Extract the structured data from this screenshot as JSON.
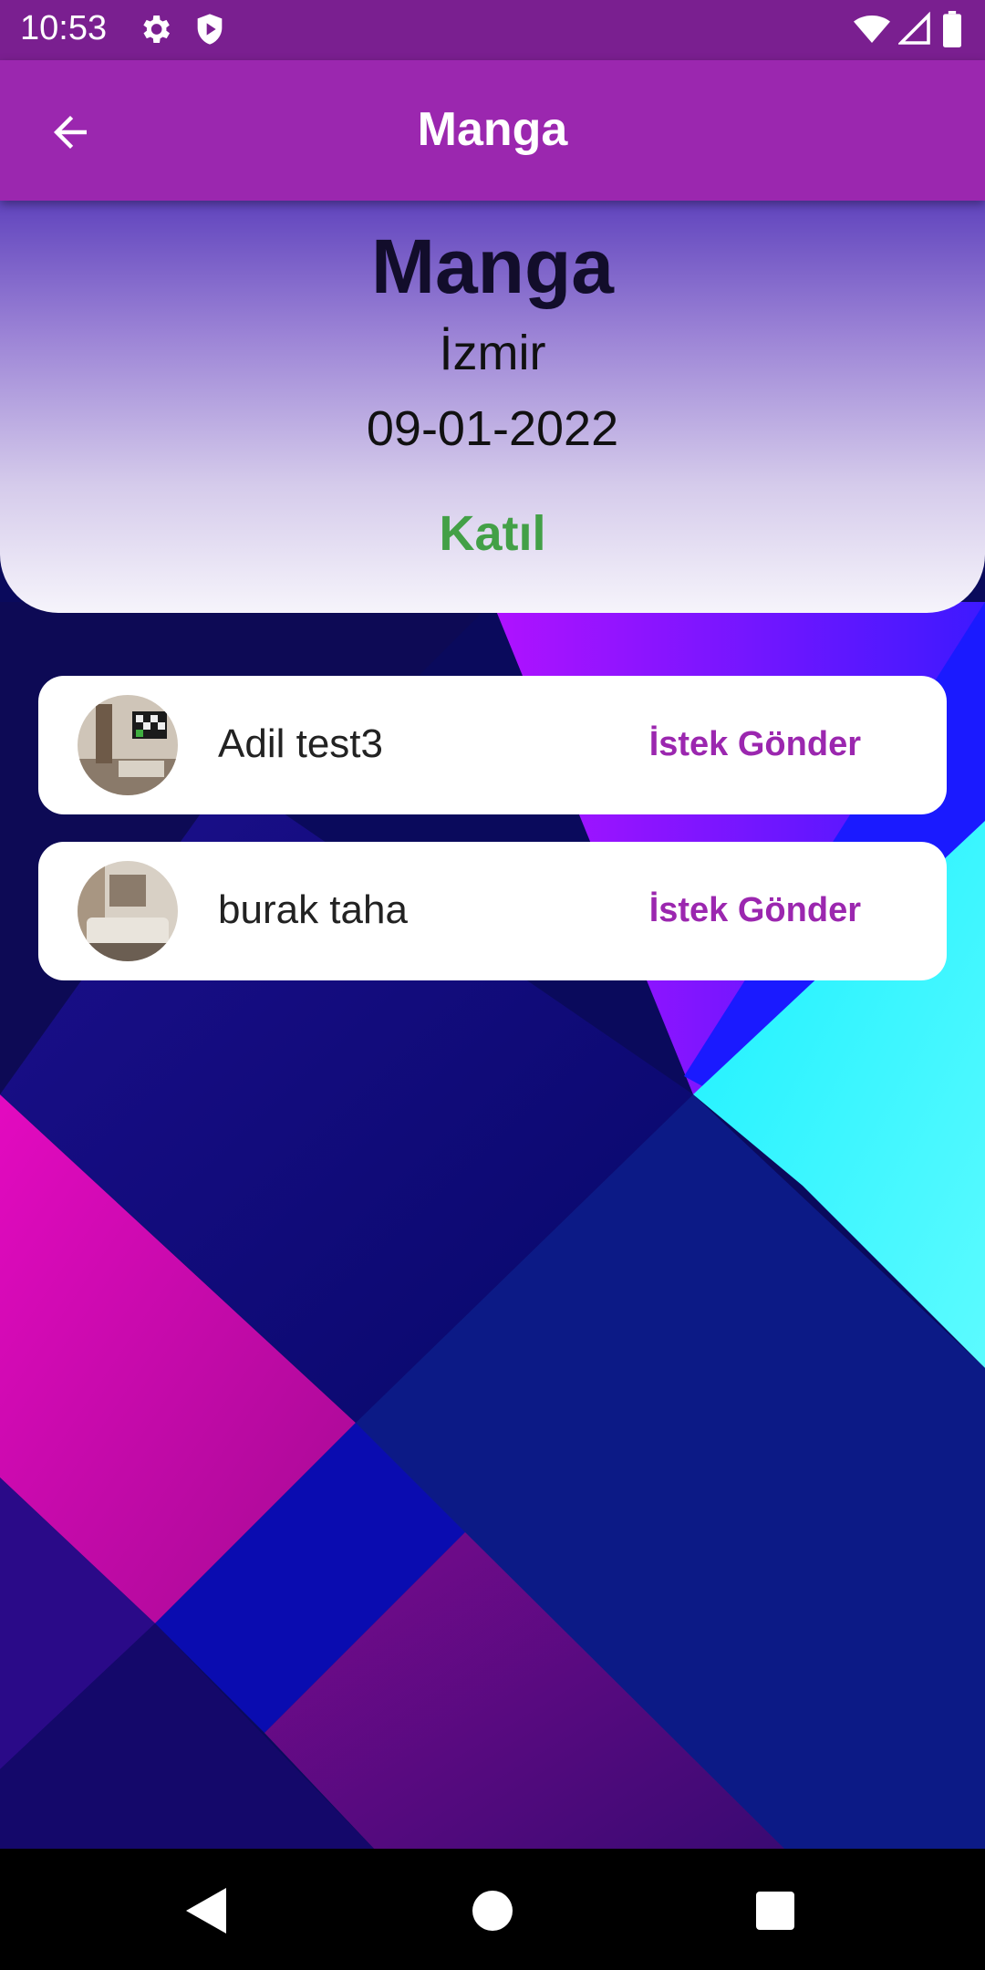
{
  "status_bar": {
    "time": "10:53"
  },
  "app_bar": {
    "title": "Manga"
  },
  "event": {
    "title": "Manga",
    "city": "İzmir",
    "date": "09-01-2022",
    "join_label": "Katıl"
  },
  "members": [
    {
      "name": "Adil test3",
      "action_label": "İstek Gönder"
    },
    {
      "name": "burak taha",
      "action_label": "İstek Gönder"
    }
  ],
  "colors": {
    "status_bar": "#7a1f90",
    "app_bar": "#9b27af",
    "join": "#43a047",
    "action": "#9b27af"
  }
}
